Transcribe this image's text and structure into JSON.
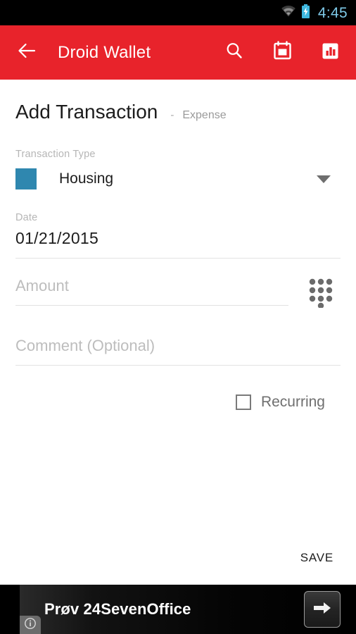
{
  "status_bar": {
    "time": "4:45",
    "wifi_icon": "wifi-icon",
    "battery_icon": "battery-charging-icon",
    "time_color": "#7ec9e8",
    "background": "#000000"
  },
  "app_bar": {
    "background": "#e8232b",
    "back_icon": "back-arrow-icon",
    "title": "Droid Wallet",
    "actions": [
      {
        "icon": "search-icon",
        "label": "Search"
      },
      {
        "icon": "calendar-icon",
        "label": "Calendar"
      },
      {
        "icon": "bar-chart-icon",
        "label": "Statistics"
      }
    ]
  },
  "form": {
    "title": "Add Transaction",
    "title_separator": "-",
    "subtitle": "Expense",
    "transaction_type": {
      "label": "Transaction Type",
      "value": "Housing",
      "swatch_color": "#2f87af",
      "dropdown_icon": "chevron-down-icon"
    },
    "date": {
      "label": "Date",
      "value": "01/21/2015"
    },
    "amount": {
      "placeholder": "Amount",
      "value": "",
      "keypad_icon": "dialpad-icon"
    },
    "comment": {
      "placeholder": "Comment (Optional)",
      "value": ""
    },
    "recurring": {
      "label": "Recurring",
      "checked": false
    },
    "save_label": "SAVE"
  },
  "ad": {
    "text": "Prøv 24SevenOffice",
    "arrow_icon": "arrow-right-icon",
    "info_icon": "info-icon",
    "background": "#000000"
  }
}
